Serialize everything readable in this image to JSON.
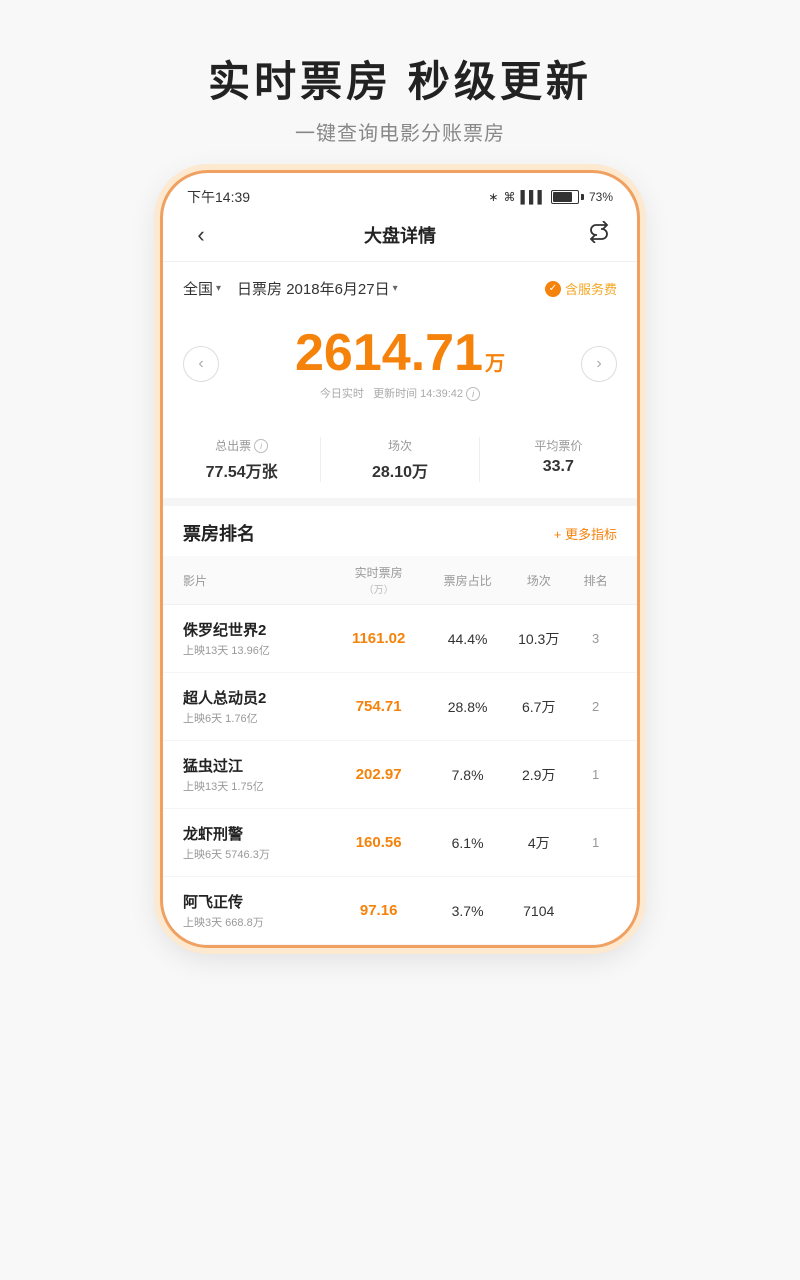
{
  "page": {
    "title_main": "实时票房  秒级更新",
    "title_sub": "一键查询电影分账票房"
  },
  "phone": {
    "status_bar": {
      "time": "下午14:39",
      "icons_text": "* ☁ ⊕ ▌▌▌ 73%"
    },
    "nav": {
      "back_icon": "‹",
      "title": "大盘详情",
      "share_icon": "⎋"
    },
    "filter": {
      "region": "全国",
      "region_arrow": "▾",
      "date_label": "日票房 2018年6月27日",
      "date_arrow": "▾",
      "service_check": "✓",
      "service_label": "含服务费"
    },
    "revenue": {
      "amount": "2614.71",
      "unit": "万",
      "realtime_label": "今日实时",
      "update_prefix": "更新时间",
      "update_time": "14:39:42",
      "left_arrow": "‹",
      "right_arrow": "›"
    },
    "stats": [
      {
        "label": "总出票",
        "has_info": true,
        "value": "77.54万张"
      },
      {
        "label": "场次",
        "has_info": false,
        "value": "28.10万"
      },
      {
        "label": "平均票价",
        "has_info": false,
        "value": "33.7"
      }
    ],
    "ranking": {
      "title": "票房排名",
      "more_label": "+ 更多指标",
      "table_headers": {
        "movie": "影片",
        "realtime": "实时票房",
        "realtime_sub": "（万）",
        "ratio": "票房占比",
        "sessions": "场次",
        "rank": "排名"
      },
      "movies": [
        {
          "name": "侏罗纪世界2",
          "meta": "上映13天 13.96亿",
          "revenue": "1161.02",
          "ratio": "44.4%",
          "sessions": "10.3万",
          "rank": "3"
        },
        {
          "name": "超人总动员2",
          "meta": "上映6天 1.76亿",
          "revenue": "754.71",
          "ratio": "28.8%",
          "sessions": "6.7万",
          "rank": "2"
        },
        {
          "name": "猛虫过江",
          "meta": "上映13天 1.75亿",
          "revenue": "202.97",
          "ratio": "7.8%",
          "sessions": "2.9万",
          "rank": "1"
        },
        {
          "name": "龙虾刑警",
          "meta": "上映6天 5746.3万",
          "revenue": "160.56",
          "ratio": "6.1%",
          "sessions": "4万",
          "rank": "1"
        },
        {
          "name": "阿飞正传",
          "meta": "上映3天 668.8万",
          "revenue": "97.16",
          "ratio": "3.7%",
          "sessions": "7104",
          "rank": ""
        }
      ]
    }
  }
}
